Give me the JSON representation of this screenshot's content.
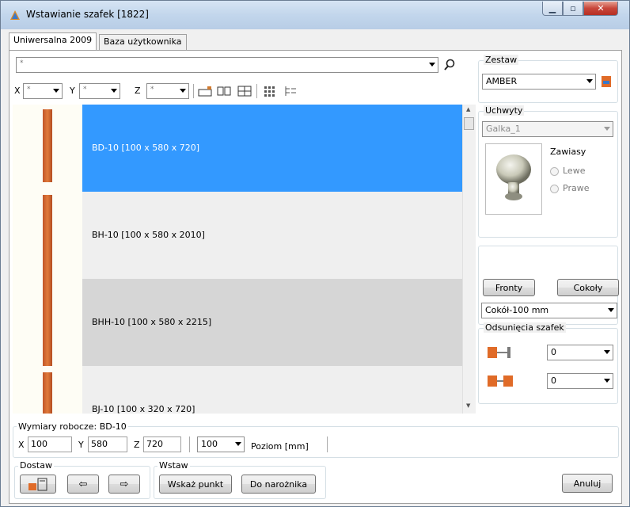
{
  "window": {
    "title": "Wstawianie szafek [1822]"
  },
  "tabs": [
    {
      "label": "Uniwersalna 2009",
      "active": true
    },
    {
      "label": "Baza użytkownika",
      "active": false
    }
  ],
  "filter": {
    "search_value": "*",
    "x_label": "X",
    "x_value": "*",
    "y_label": "Y",
    "y_value": "*",
    "z_label": "Z",
    "z_value": "*"
  },
  "list": {
    "items": [
      {
        "label": "BD-10  [100 x 580 x 720]",
        "selected": true
      },
      {
        "label": "BH-10  [100 x 580 x 2010]",
        "selected": false
      },
      {
        "label": "BHH-10  [100 x 580 x 2215]",
        "selected": false
      },
      {
        "label": "BJ-10  [100 x 320 x 720]",
        "selected": false
      }
    ]
  },
  "zestaw": {
    "title": "Zestaw",
    "value": "AMBER"
  },
  "uchwyty": {
    "title": "Uchwyty",
    "value": "Galka_1",
    "hinges_title": "Zawiasy",
    "left": "Lewe",
    "right": "Prawe"
  },
  "fronts": {
    "fronty_label": "Fronty",
    "cokoly_label": "Cokoły",
    "cokol_value": "Cokół-100 mm"
  },
  "offsets": {
    "title": "Odsunięcia szafek",
    "value1": "0",
    "value2": "0"
  },
  "dims": {
    "title": "Wymiary robocze: BD-10",
    "x_label": "X",
    "x": "100",
    "y_label": "Y",
    "y": "580",
    "z_label": "Z",
    "z": "720",
    "level": "100",
    "level_label": "Poziom [mm]"
  },
  "dostaw": {
    "title": "Dostaw"
  },
  "wstaw": {
    "title": "Wstaw",
    "point_label": "Wskaż punkt",
    "corner_label": "Do narożnika"
  },
  "cancel_label": "Anuluj",
  "colors": {
    "selected": "#3399ff",
    "row_even": "#efefef",
    "row_odd": "#d6d6d6",
    "thumb_orange": "#d9692f"
  }
}
